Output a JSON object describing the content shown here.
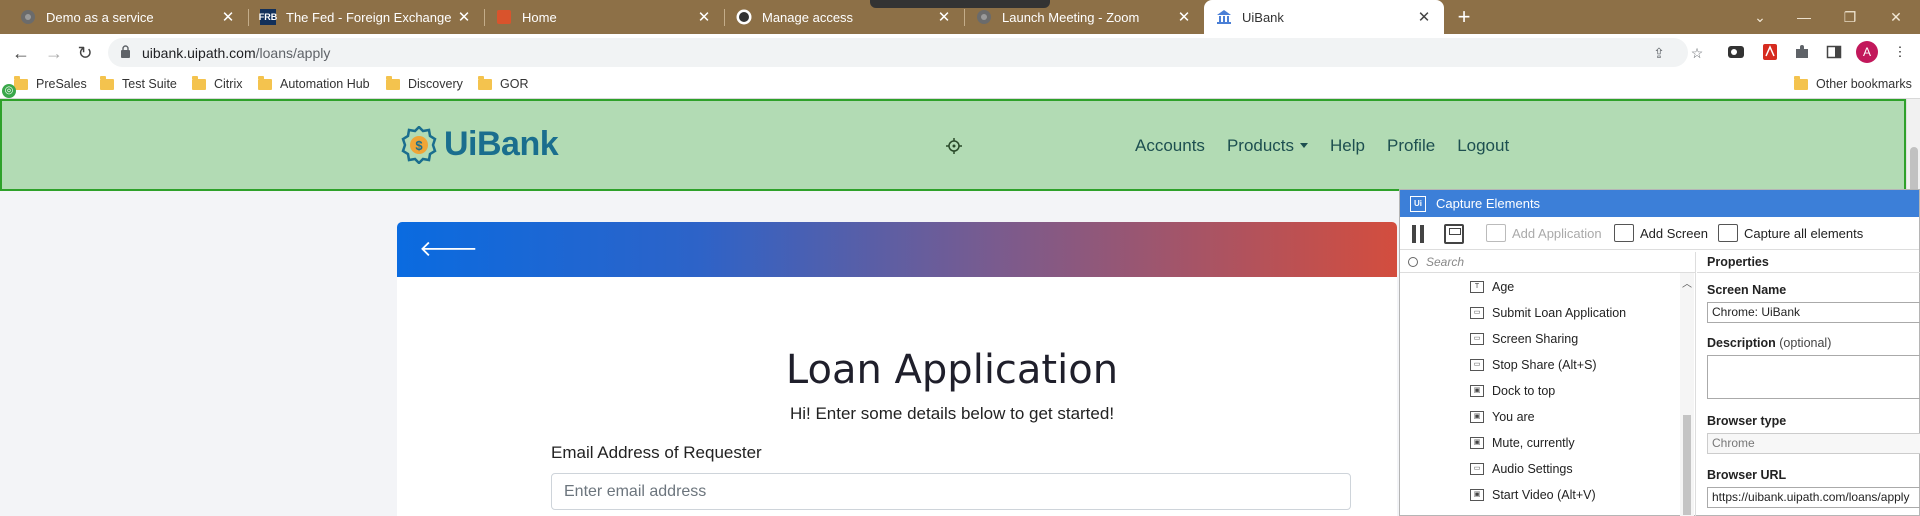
{
  "browser": {
    "tabs": [
      {
        "title": "Demo as a service",
        "favicon": "globe-icon",
        "active": false
      },
      {
        "title": "The Fed - Foreign Exchange Rate",
        "favicon": "frb-icon",
        "active": false
      },
      {
        "title": "Home",
        "favicon": "office-icon",
        "active": false
      },
      {
        "title": "Manage access",
        "favicon": "github-icon",
        "active": false
      },
      {
        "title": "Launch Meeting - Zoom",
        "favicon": "globe-icon",
        "active": false
      },
      {
        "title": "UiBank",
        "favicon": "bank-icon",
        "active": true
      }
    ],
    "frb_badge": "FRB",
    "url_host": "uibank.uipath.com",
    "url_path": "/loans/apply",
    "bookmarks": [
      "PreSales",
      "Test Suite",
      "Citrix",
      "Automation Hub",
      "Discovery",
      "GOR"
    ],
    "other_bookmarks": "Other bookmarks",
    "profile_initial": "A"
  },
  "site": {
    "brand": "UiBank",
    "nav": [
      "Accounts",
      "Products",
      "Help",
      "Profile",
      "Logout"
    ]
  },
  "form": {
    "title": "Loan Application",
    "subtitle": "Hi! Enter some details below to get started!",
    "email_label": "Email Address of Requester",
    "email_placeholder": "Enter email address"
  },
  "capture": {
    "title": "Capture Elements",
    "tools": {
      "add_application": "Add Application",
      "add_screen": "Add Screen",
      "capture_all": "Capture all elements"
    },
    "search_placeholder": "Search",
    "tree": [
      {
        "label": "Age",
        "icon": "text-field-icon"
      },
      {
        "label": "Submit Loan Application",
        "icon": "button-icon"
      },
      {
        "label": "Screen Sharing",
        "icon": "button-icon"
      },
      {
        "label": "Stop Share (Alt+S)",
        "icon": "button-icon"
      },
      {
        "label": "Dock to top",
        "icon": "image-icon"
      },
      {
        "label": "You are",
        "icon": "image-icon"
      },
      {
        "label": "Mute, currently",
        "icon": "image-icon"
      },
      {
        "label": "Audio Settings",
        "icon": "button-icon"
      },
      {
        "label": "Start Video (Alt+V)",
        "icon": "image-icon"
      }
    ],
    "properties": {
      "header": "Properties",
      "screen_name_label": "Screen Name",
      "screen_name": "Chrome: UiBank",
      "description_label": "Description",
      "description_optional": "(optional)",
      "browser_type_label": "Browser type",
      "browser_type": "Chrome",
      "browser_url_label": "Browser URL",
      "browser_url": "https://uibank.uipath.com/loans/apply"
    }
  }
}
